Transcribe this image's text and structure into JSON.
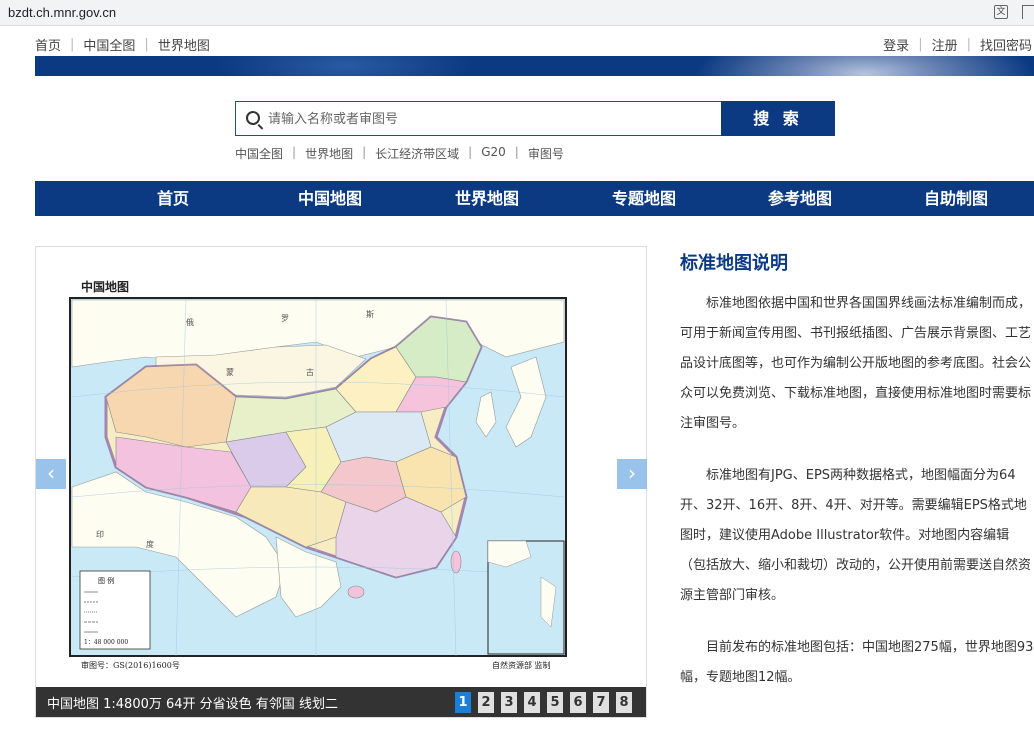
{
  "browser": {
    "url": "bzdt.ch.mnr.gov.cn"
  },
  "top_links": {
    "left": [
      "首页",
      "中国全图",
      "世界地图"
    ],
    "right": [
      "登录",
      "注册",
      "找回密码"
    ]
  },
  "search": {
    "placeholder": "请输入名称或者审图号",
    "button": "搜 索"
  },
  "quick_links": [
    "中国全图",
    "世界地图",
    "长江经济带区域",
    "G20",
    "审图号"
  ],
  "main_nav": [
    "首页",
    "中国地图",
    "世界地图",
    "专题地图",
    "参考地图",
    "自助制图"
  ],
  "slider": {
    "prev": "‹",
    "next": "›",
    "map": {
      "title": "中国地图",
      "approval_no": "审图号：GS(2016)1600号",
      "supervisor": "自然资源部  监制",
      "legend_title": "图  例",
      "scale": "1：48 000 000",
      "regions": [
        "俄",
        "罗",
        "斯",
        "蒙",
        "古",
        "印",
        "度"
      ]
    },
    "caption": "中国地图 1:4800万 64开 分省设色 有邻国 线划二",
    "pages": [
      "1",
      "2",
      "3",
      "4",
      "5",
      "6",
      "7",
      "8"
    ],
    "active_page": "1"
  },
  "description": {
    "title": "标准地图说明",
    "paragraphs": [
      "标准地图依据中国和世界各国国界线画法标准编制而成，可用于新闻宣传用图、书刊报纸插图、广告展示背景图、工艺品设计底图等，也可作为编制公开版地图的参考底图。社会公众可以免费浏览、下载标准地图，直接使用标准地图时需要标注审图号。",
      "标准地图有JPG、EPS两种数据格式，地图幅面分为64开、32开、16开、8开、4开、对开等。需要编辑EPS格式地图时，建议使用Adobe Illustrator软件。对地图内容编辑（包括放大、缩小和裁切）改动的，公开使用前需要送自然资源主管部门审核。",
      "目前发布的标准地图包括：中国地图275幅，世界地图93幅，专题地图12幅。"
    ]
  },
  "colors": {
    "brand": "#0b3a82",
    "pager_active": "#1a7fd9",
    "caption_bg": "#333333"
  }
}
